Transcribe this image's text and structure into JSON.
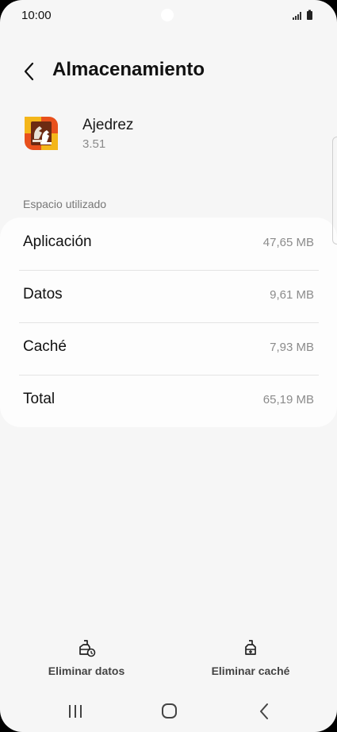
{
  "status_bar": {
    "time": "10:00",
    "icons": [
      "signal-icon",
      "battery-icon"
    ]
  },
  "header": {
    "title": "Almacenamiento",
    "back_icon": "chevron-left-icon"
  },
  "app": {
    "name": "Ajedrez",
    "version": "3.51",
    "icon": "chess-app-icon"
  },
  "storage": {
    "section_label": "Espacio utilizado",
    "rows": [
      {
        "label": "Aplicación",
        "value": "47,65 MB"
      },
      {
        "label": "Datos",
        "value": "9,61 MB"
      },
      {
        "label": "Caché",
        "value": "7,93 MB"
      },
      {
        "label": "Total",
        "value": "65,19 MB"
      }
    ]
  },
  "actions": {
    "clear_data": {
      "label": "Eliminar datos",
      "icon": "clear-data-icon"
    },
    "clear_cache": {
      "label": "Eliminar caché",
      "icon": "clear-cache-icon"
    }
  },
  "nav_bar": {
    "icons": [
      "recent-apps-icon",
      "home-icon",
      "back-icon"
    ]
  },
  "colors": {
    "background": "#f6f6f6",
    "card": "#fdfdfd",
    "text_primary": "#111111",
    "text_secondary": "#8b8b8b"
  }
}
